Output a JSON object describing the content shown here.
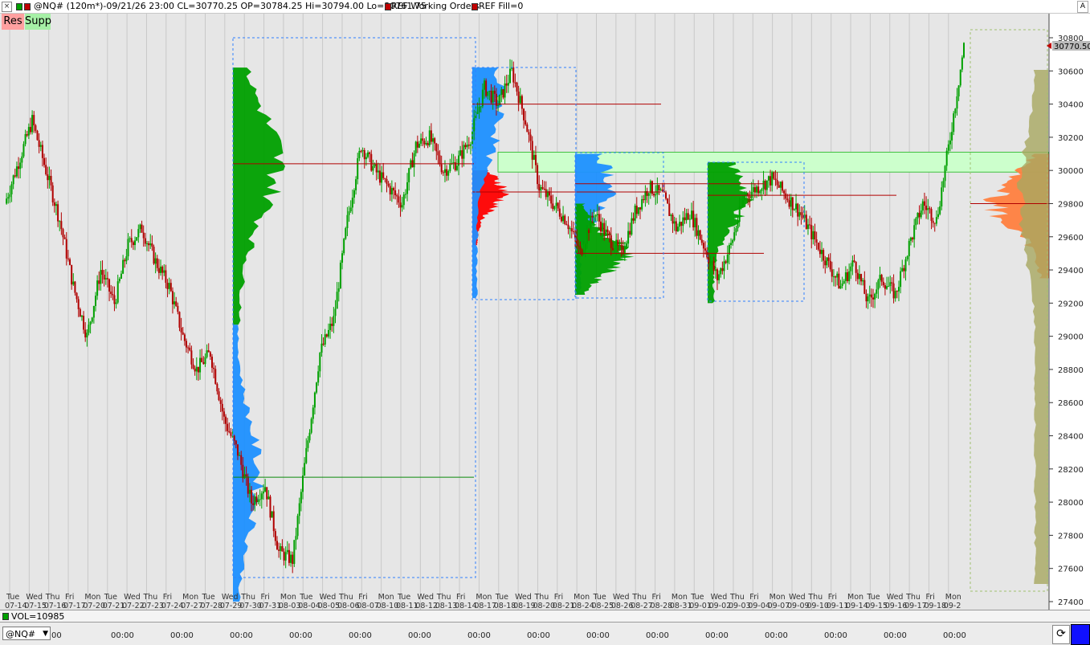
{
  "titlebar": {
    "close_icon": "×",
    "text": "@NQ# (120m*)-09/21/26 23:00 CL=30770.25 OP=30784.25 Hi=30794.00 Lo=30761.75",
    "ref_working_orders": "REF Working Orders",
    "ref_fill": "REF Fill=0",
    "right_button": "A"
  },
  "buttons": {
    "res": "Res",
    "supp": "Supp"
  },
  "volume": {
    "label": "VOL=10985"
  },
  "bottom": {
    "symbol": "@NQ#",
    "time_labels": [
      "00",
      "00:00",
      "00:00",
      "00:00",
      "00:00",
      "00:00",
      "00:00",
      "00:00",
      "00:00",
      "00:00",
      "00:00",
      "00:00",
      "00:00",
      "00:00",
      "00:00",
      "00:00"
    ]
  },
  "chart_data": {
    "type": "candlestick",
    "symbol": "@NQ#",
    "interval": "120m",
    "last_price": "30770.50",
    "colors": {
      "up": "#00a000",
      "down": "#b00000",
      "profile_green": "#00a000",
      "profile_blue": "#1e90ff",
      "profile_red": "#ff0000",
      "profile_orange": "#ff7f3f",
      "zone": "#ccffcc"
    },
    "y_ticks": [
      30800,
      30600,
      30400,
      30200,
      30000,
      29800,
      29600,
      29400,
      29200,
      29000,
      28800,
      28600,
      28400,
      28200,
      28000,
      27800,
      27600,
      27400
    ],
    "ylim": [
      27400,
      30800
    ],
    "x_day_labels": [
      "Tue",
      "Wed",
      "Thu",
      "Fri",
      "Mon",
      "Tue",
      "Wed",
      "Thu",
      "Fri",
      "Mon",
      "Tue",
      "Wed",
      "Thu",
      "Fri",
      "Mon",
      "Tue",
      "Wed",
      "Thu",
      "Fri",
      "Mon",
      "Tue",
      "Wed",
      "Thu",
      "Fri",
      "Mon",
      "Tue",
      "Wed",
      "Thu",
      "Fri",
      "Mon",
      "Tue",
      "Wed",
      "Thu",
      "Fri",
      "Mon",
      "Tue",
      "Wed",
      "Thu",
      "Fri",
      "Mon",
      "Wed",
      "Thu",
      "Fri",
      "Mon",
      "Tue",
      "Wed",
      "Thu",
      "Fri",
      "Mon"
    ],
    "x_date_labels": [
      "07-14",
      "07-15",
      "07-16",
      "07-17",
      "07-20",
      "07-21",
      "07-22",
      "07-23",
      "07-24",
      "07-27",
      "07-28",
      "07-29",
      "07-30",
      "07-31",
      "08-03",
      "08-04",
      "08-05",
      "08-06",
      "08-07",
      "08-10",
      "08-11",
      "08-12",
      "08-13",
      "08-14",
      "08-17",
      "08-18",
      "08-19",
      "08-20",
      "08-21",
      "08-24",
      "08-25",
      "08-26",
      "08-27",
      "08-28",
      "08-31",
      "09-01",
      "09-02",
      "09-03",
      "09-04",
      "09-07",
      "09-09",
      "09-10",
      "09-11",
      "09-14",
      "09-15",
      "09-16",
      "09-17",
      "09-18",
      "09-2"
    ],
    "price_path": [
      [
        0,
        29800
      ],
      [
        1,
        30050
      ],
      [
        2,
        30300
      ],
      [
        3,
        30000
      ],
      [
        4,
        29700
      ],
      [
        5,
        29300
      ],
      [
        6,
        29000
      ],
      [
        7,
        29400
      ],
      [
        8,
        29200
      ],
      [
        9,
        29550
      ],
      [
        10,
        29650
      ],
      [
        11,
        29450
      ],
      [
        12,
        29300
      ],
      [
        13,
        29000
      ],
      [
        14,
        28800
      ],
      [
        15,
        28900
      ],
      [
        16,
        28500
      ],
      [
        17,
        28300
      ],
      [
        18,
        28000
      ],
      [
        19,
        28100
      ],
      [
        20,
        27700
      ],
      [
        21,
        27650
      ],
      [
        22,
        28300
      ],
      [
        23,
        28900
      ],
      [
        24,
        29100
      ],
      [
        25,
        29700
      ],
      [
        26,
        30150
      ],
      [
        27,
        30000
      ],
      [
        28,
        29900
      ],
      [
        29,
        29800
      ],
      [
        30,
        30150
      ],
      [
        31,
        30200
      ],
      [
        32,
        30000
      ],
      [
        33,
        30050
      ],
      [
        34,
        30200
      ],
      [
        35,
        30500
      ],
      [
        36,
        30400
      ],
      [
        37,
        30600
      ],
      [
        38,
        30300
      ],
      [
        39,
        29900
      ],
      [
        40,
        29800
      ],
      [
        41,
        29700
      ],
      [
        42,
        29500
      ],
      [
        43,
        29750
      ],
      [
        44,
        29600
      ],
      [
        45,
        29500
      ],
      [
        46,
        29750
      ],
      [
        47,
        29900
      ],
      [
        48,
        29850
      ],
      [
        49,
        29650
      ],
      [
        50,
        29750
      ],
      [
        51,
        29550
      ],
      [
        52,
        29350
      ],
      [
        53,
        29550
      ],
      [
        54,
        29850
      ],
      [
        55,
        29900
      ],
      [
        56,
        29950
      ],
      [
        57,
        29850
      ],
      [
        58,
        29750
      ],
      [
        59,
        29600
      ],
      [
        60,
        29450
      ],
      [
        61,
        29300
      ],
      [
        62,
        29450
      ],
      [
        63,
        29200
      ],
      [
        64,
        29350
      ],
      [
        65,
        29250
      ],
      [
        66,
        29550
      ],
      [
        67,
        29800
      ],
      [
        68,
        29700
      ],
      [
        69,
        30200
      ],
      [
        70,
        30750
      ]
    ],
    "profiles": [
      {
        "range": [
          29070,
          30620
        ],
        "poc": 30040,
        "color": "green"
      },
      {
        "range": [
          27400,
          29070
        ],
        "poc": 28150,
        "color": "blue"
      },
      {
        "range": [
          29550,
          30000
        ],
        "poc": 29870,
        "color": "red"
      },
      {
        "range": [
          29230,
          30620
        ],
        "poc": 30400,
        "color": "blue"
      },
      {
        "range": [
          29250,
          30100
        ],
        "poc": 29920,
        "color": "blue"
      },
      {
        "range": [
          29250,
          29800
        ],
        "poc": 29500,
        "color": "green"
      },
      {
        "range": [
          29200,
          30050
        ],
        "poc": 29850,
        "color": "green"
      },
      {
        "range": [
          29350,
          30100
        ],
        "poc": 29800,
        "color": "orange"
      }
    ],
    "zone": {
      "low": 29990,
      "high": 30110
    }
  }
}
